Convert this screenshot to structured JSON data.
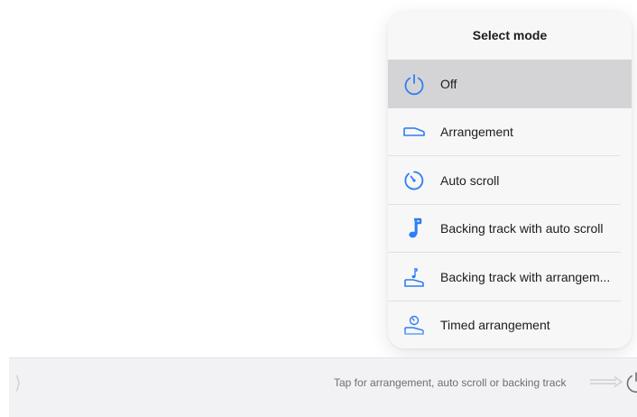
{
  "popover": {
    "title": "Select mode",
    "items": [
      {
        "label": "Off",
        "icon": "power-icon",
        "selected": true
      },
      {
        "label": "Arrangement",
        "icon": "arrangement-icon",
        "selected": false
      },
      {
        "label": "Auto scroll",
        "icon": "auto-scroll-icon",
        "selected": false
      },
      {
        "label": "Backing track with auto scroll",
        "icon": "music-note-icon",
        "selected": false
      },
      {
        "label": "Backing track with arrangem...",
        "icon": "backing-track-arrangement-icon",
        "selected": false
      },
      {
        "label": "Timed arrangement",
        "icon": "timed-arrangement-icon",
        "selected": false
      }
    ]
  },
  "bottom_bar": {
    "hint": "Tap for arrangement, auto scroll or backing track",
    "arrow_icon": "right-arrow-icon",
    "power_icon": "power-icon"
  },
  "colors": {
    "accent": "#2f7df6",
    "selected_row": "#d4d4d6",
    "popover_bg": "#f7f7f8",
    "bar_bg": "#f2f2f4"
  }
}
